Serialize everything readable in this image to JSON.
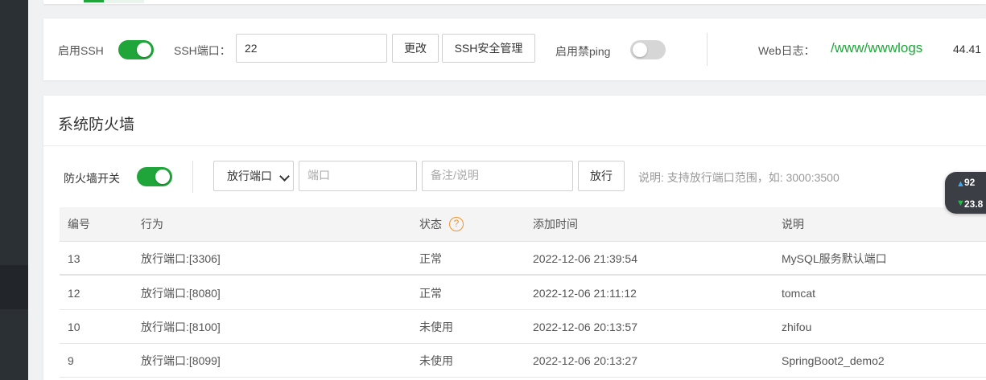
{
  "ssh_panel": {
    "enable_ssh_label": "启用SSH",
    "enable_ssh_on": true,
    "ssh_port_label": "SSH端口：",
    "ssh_port_value": "22",
    "change_button": "更改",
    "ssh_security_button": "SSH安全管理",
    "ping_label": "启用禁ping",
    "ping_on": false,
    "web_log_label": "Web日志：",
    "web_log_path": "/www/wwwlogs",
    "web_log_size": "44.41"
  },
  "firewall": {
    "title": "系统防火墙",
    "switch_label": "防火墙开关",
    "switch_on": true,
    "mode_select": "放行端口",
    "port_placeholder": "端口",
    "remark_placeholder": "备注/说明",
    "allow_button": "放行",
    "hint": "说明: 支持放行端口范围，如: 3000:3500",
    "columns": {
      "id": "编号",
      "action": "行为",
      "status": "状态",
      "added": "添加时间",
      "desc": "说明"
    },
    "rows": [
      {
        "id": "13",
        "action": "放行端口:[3306]",
        "status": "正常",
        "added": "2022-12-06 21:39:54",
        "desc": "MySQL服务默认端口"
      },
      {
        "id": "12",
        "action": "放行端口:[8080]",
        "status": "正常",
        "added": "2022-12-06 21:11:12",
        "desc": "tomcat"
      },
      {
        "id": "10",
        "action": "放行端口:[8100]",
        "status": "未使用",
        "added": "2022-12-06 20:13:57",
        "desc": "zhifou"
      },
      {
        "id": "9",
        "action": "放行端口:[8099]",
        "status": "未使用",
        "added": "2022-12-06 20:13:27",
        "desc": "SpringBoot2_demo2"
      }
    ]
  },
  "speed_widget": {
    "up_icon": "arrow-up-icon",
    "down_icon": "arrow-down-icon",
    "up_value": "92",
    "down_value": "23.8"
  },
  "colors": {
    "accent_green": "#20a53a",
    "help_orange": "#f0932b",
    "sidebar": "#2b3035"
  }
}
